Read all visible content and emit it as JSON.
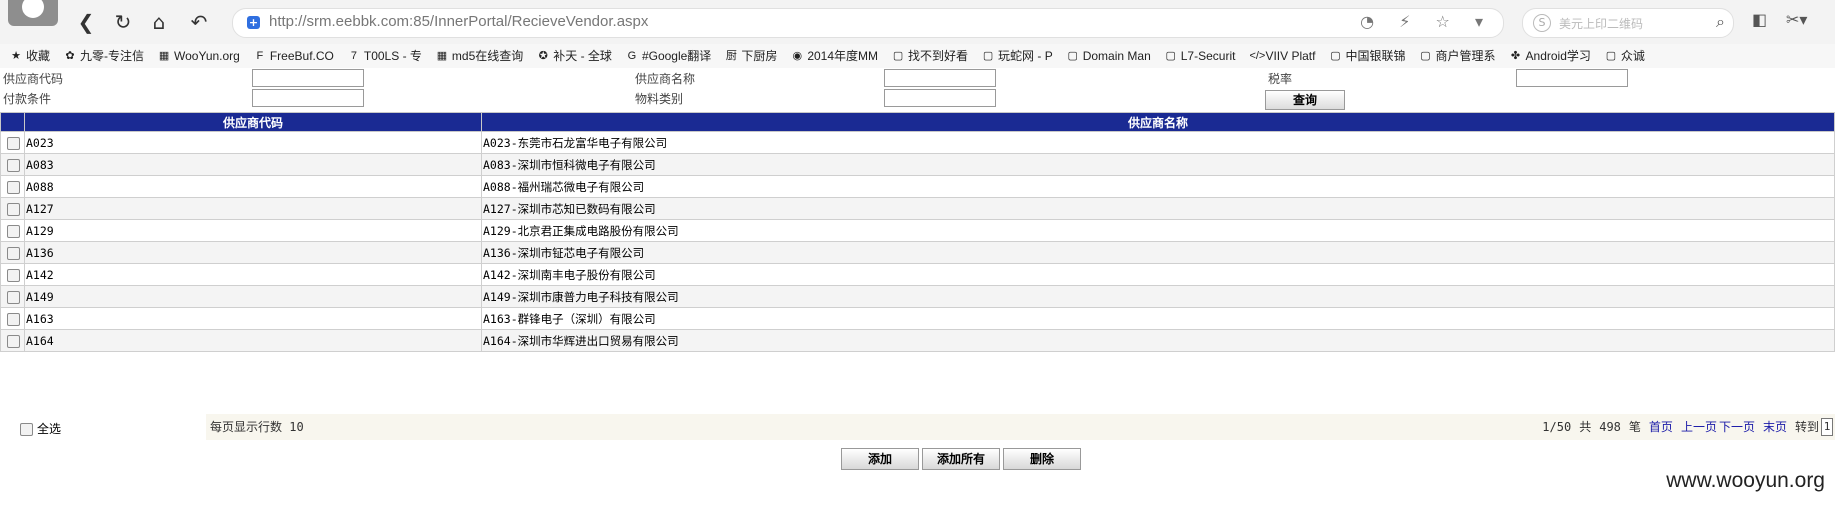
{
  "browser": {
    "url": "http://srm.eebbk.com:85/InnerPortal/RecieveVendor.aspx",
    "url_right_icons": "◔ ⚡ ☆ ▾",
    "search_placeholder": "美元上印二维码",
    "nav": {
      "back": "❮",
      "reload": "↻",
      "home": "⌂",
      "undo": "↶"
    },
    "bookmarks": [
      {
        "label": "收藏",
        "icon": "★"
      },
      {
        "label": "九零-专注信",
        "icon": "✿"
      },
      {
        "label": "WooYun.org",
        "icon": "▦"
      },
      {
        "label": "FreeBuf.CO",
        "icon": "F"
      },
      {
        "label": "T00LS - 专",
        "icon": "7"
      },
      {
        "label": "md5在线查询",
        "icon": "▦"
      },
      {
        "label": "补天 - 全球",
        "icon": "✪"
      },
      {
        "label": "#Google翻译",
        "icon": "G"
      },
      {
        "label": "下厨房",
        "icon": "厨"
      },
      {
        "label": "2014年度MM",
        "icon": "◉"
      },
      {
        "label": "找不到好看",
        "icon": "▢"
      },
      {
        "label": "玩蛇网 - P",
        "icon": "▢"
      },
      {
        "label": "Domain Man",
        "icon": "▢"
      },
      {
        "label": "L7-Securit",
        "icon": "▢"
      },
      {
        "label": "VIIV Platf",
        "icon": "</>"
      },
      {
        "label": "中国银联锦",
        "icon": "▢"
      },
      {
        "label": "商户管理系",
        "icon": "▢"
      },
      {
        "label": "Android学习",
        "icon": "✤"
      },
      {
        "label": "众诚",
        "icon": "▢"
      }
    ]
  },
  "filters": {
    "vendor_code_label": "供应商代码",
    "vendor_name_label": "供应商名称",
    "tax_rate_label": "税率",
    "payment_terms_label": "付款条件",
    "material_category_label": "物料类别",
    "query_button": "查询"
  },
  "table": {
    "headers": [
      "供应商代码",
      "供应商名称"
    ],
    "rows": [
      {
        "code": "A023",
        "name": "A023-东莞市石龙富华电子有限公司"
      },
      {
        "code": "A083",
        "name": "A083-深圳市恒科微电子有限公司"
      },
      {
        "code": "A088",
        "name": "A088-福州瑞芯微电子有限公司"
      },
      {
        "code": "A127",
        "name": "A127-深圳市芯知已数码有限公司"
      },
      {
        "code": "A129",
        "name": "A129-北京君正集成电路股份有限公司"
      },
      {
        "code": "A136",
        "name": "A136-深圳市钲芯电子有限公司"
      },
      {
        "code": "A142",
        "name": "A142-深圳南丰电子股份有限公司"
      },
      {
        "code": "A149",
        "name": "A149-深圳市康普力电子科技有限公司"
      },
      {
        "code": "A163",
        "name": "A163-群锋电子（深圳）有限公司"
      },
      {
        "code": "A164",
        "name": "A164-深圳市华辉进出口贸易有限公司"
      }
    ]
  },
  "footer": {
    "select_all": "全选",
    "rows_per_page": "每页显示行数 10",
    "page_info": "1/50",
    "total_prefix": "共",
    "total": "498",
    "total_suffix": "笔",
    "first": "首页",
    "prev": "上一页",
    "next": "下一页",
    "last": "末页",
    "goto": "转到",
    "goto_value": "1"
  },
  "actions": {
    "add": "添加",
    "add_all": "添加所有",
    "delete": "删除"
  },
  "watermark": "www.wooyun.org"
}
